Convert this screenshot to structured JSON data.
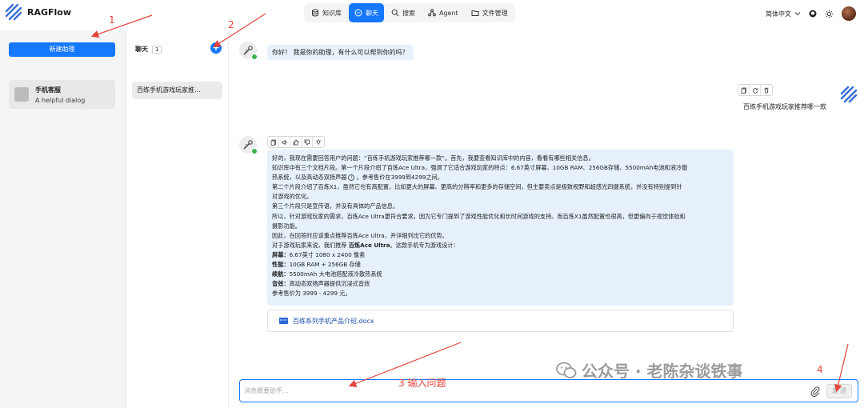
{
  "header": {
    "app_name": "RAGFlow",
    "nav": [
      {
        "label": "知识库",
        "icon": "database-icon",
        "active": false
      },
      {
        "label": "聊天",
        "icon": "chat-icon",
        "active": true
      },
      {
        "label": "搜索",
        "icon": "search-icon",
        "active": false
      },
      {
        "label": "Agent",
        "icon": "agent-icon",
        "active": false
      },
      {
        "label": "文件管理",
        "icon": "folder-icon",
        "active": false
      }
    ],
    "language": "简体中文"
  },
  "left_panel": {
    "new_assistant_label": "新建助理",
    "assistants": [
      {
        "name": "手机客服",
        "description": "A helpful dialog"
      }
    ]
  },
  "middle_panel": {
    "title": "聊天",
    "count": "1",
    "add_label": "+",
    "conversations": [
      "百练手机游戏玩家推..."
    ]
  },
  "chat": {
    "greeting": "你好！ 我是你的助理，有什么可以帮到你的吗？",
    "user_question": "百练手机游戏玩家推荐哪一款",
    "answer_lines": [
      "好的，我现在需要回答用户的问题：“百练手机游戏玩家推荐哪一款”。首先，我要查看知识库中的内容，看看有哪些相关信息。",
      "知识库中有三个文档片段。第一个片段介绍了百炼Ace Ultra，强调了它适合游戏玩家的特点：6.67英寸屏幕、10GB RAM、256GB存储、5500mAh电池和液冷散",
      "热系统，以及高动态双扬声器",
      "。参考售价在3999到4299之间。",
      "第二个片段介绍了百炼X1，虽然它也有高配置，比如更大的屏幕、更高的分辨率和更多的存储空间，但主要卖点是极致视野和超感光四摄系统，并没有特别提到针",
      "对游戏的优化。",
      "第三个片段只是宣传语，并没有具体的产品信息。",
      "所以，针对游戏玩家的需求，百炼Ace Ultra更符合要求。因为它专门提到了游戏性能优化和长时间游戏的支持。而百炼X1虽然配置也很高，但更偏向于视觉体验和",
      "摄影功能。",
      "因此，在回答时应该重点推荐百炼Ace Ultra，并详细列出它的优势。",
      "对于游戏玩家来说，我们推荐",
      "百炼Ace Ultra",
      "。这款手机专为游戏设计："
    ],
    "cite_mark": "i",
    "specs": [
      {
        "label": "屏幕：",
        "value": "6.67英寸 1080 x 2400 像素"
      },
      {
        "label": "性能：",
        "value": "10GB RAM + 256GB 存储"
      },
      {
        "label": "续航：",
        "value": "5500mAh 大电池搭配液冷散热系统"
      },
      {
        "label": "音效：",
        "value": "高动态双扬声器提供沉浸式音效"
      }
    ],
    "price_line": "参考售价为 3999 - 4299 元。",
    "document": "百练系列手机产品介绍.docx",
    "input_placeholder": "消息概要助手...",
    "send_label": "发 送"
  },
  "annotations": [
    "1",
    "2",
    "3 输入问题",
    "4"
  ],
  "watermark": "公众号 · 老陈杂谈铁事",
  "colors": {
    "primary": "#1677ff",
    "annotation": "#e2433c",
    "answer_bg": "#e6f1fb"
  }
}
